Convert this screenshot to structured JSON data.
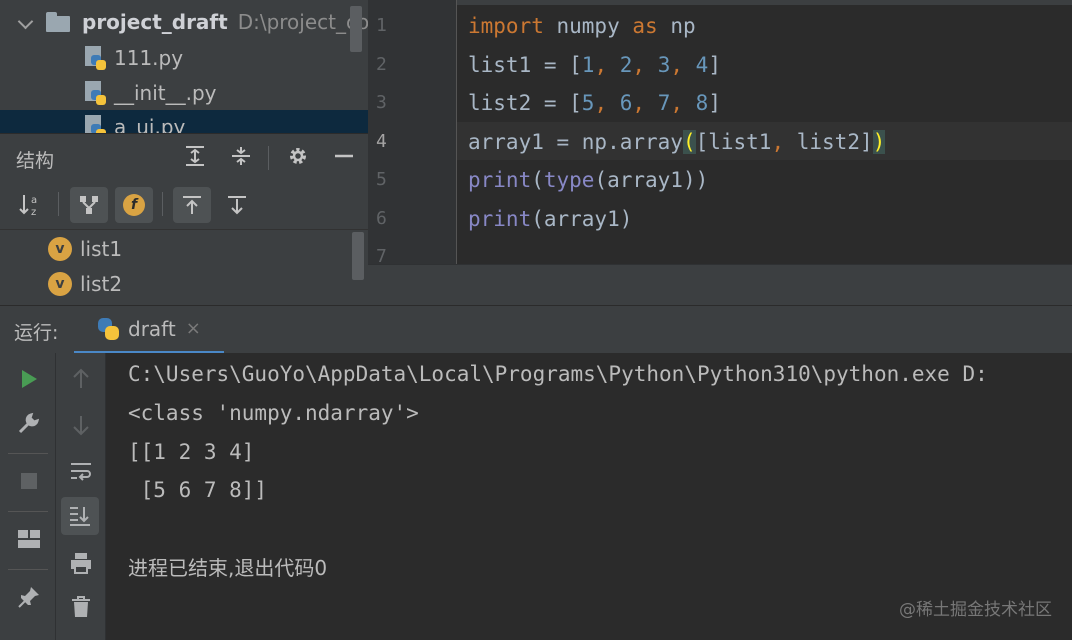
{
  "project_tree": {
    "root_name": "project_draft",
    "root_path": "D:\\project_coo",
    "files": [
      "111.py",
      "__init__.py",
      "a_ui.py"
    ]
  },
  "structure": {
    "title": "结构",
    "items": [
      {
        "badge": "v",
        "name": "list1"
      },
      {
        "badge": "v",
        "name": "list2"
      }
    ],
    "toolbar_f_label": "f"
  },
  "editor": {
    "line_numbers": [
      "1",
      "2",
      "3",
      "4",
      "5",
      "6",
      "7"
    ],
    "lines": [
      [
        {
          "t": "import",
          "c": "kw"
        },
        {
          "t": " numpy ",
          "c": "gray"
        },
        {
          "t": "as",
          "c": "kw"
        },
        {
          "t": " np",
          "c": "gray"
        }
      ],
      [
        {
          "t": "list1 = [",
          "c": "gray"
        },
        {
          "t": "1",
          "c": "num"
        },
        {
          "t": ", ",
          "c": "kw"
        },
        {
          "t": "2",
          "c": "num"
        },
        {
          "t": ", ",
          "c": "kw"
        },
        {
          "t": "3",
          "c": "num"
        },
        {
          "t": ", ",
          "c": "kw"
        },
        {
          "t": "4",
          "c": "num"
        },
        {
          "t": "]",
          "c": "gray"
        }
      ],
      [
        {
          "t": "list2 = [",
          "c": "gray"
        },
        {
          "t": "5",
          "c": "num"
        },
        {
          "t": ", ",
          "c": "kw"
        },
        {
          "t": "6",
          "c": "num"
        },
        {
          "t": ", ",
          "c": "kw"
        },
        {
          "t": "7",
          "c": "num"
        },
        {
          "t": ", ",
          "c": "kw"
        },
        {
          "t": "8",
          "c": "num"
        },
        {
          "t": "]",
          "c": "gray"
        }
      ],
      [
        {
          "t": "array1 = np.array",
          "c": "gray"
        },
        {
          "t": "(",
          "c": "brk"
        },
        {
          "t": "[list1",
          "c": "gray"
        },
        {
          "t": ", ",
          "c": "kw"
        },
        {
          "t": "list2]",
          "c": "gray"
        },
        {
          "t": ")",
          "c": "brk"
        }
      ],
      [
        {
          "t": "print",
          "c": "bi"
        },
        {
          "t": "(",
          "c": "gray"
        },
        {
          "t": "type",
          "c": "bi"
        },
        {
          "t": "(array1))",
          "c": "gray"
        }
      ],
      [
        {
          "t": "print",
          "c": "bi"
        },
        {
          "t": "(array1)",
          "c": "gray"
        }
      ],
      []
    ]
  },
  "run": {
    "label": "运行:",
    "tab_name": "draft",
    "tab_close": "×",
    "console_lines": [
      "C:\\Users\\GuoYo\\AppData\\Local\\Programs\\Python\\Python310\\python.exe D:",
      "<class 'numpy.ndarray'>",
      "[[1 2 3 4]",
      " [5 6 7 8]]",
      "",
      "进程已结束,退出代码0"
    ]
  },
  "watermark": "@稀土掘金技术社区",
  "colors": {
    "keyword": "#cc7832",
    "number": "#6897bb",
    "builtin": "#8888c6",
    "bracket_match": "#ffef28",
    "run_green": "#499c54",
    "tab_underline": "#4a88c7"
  }
}
